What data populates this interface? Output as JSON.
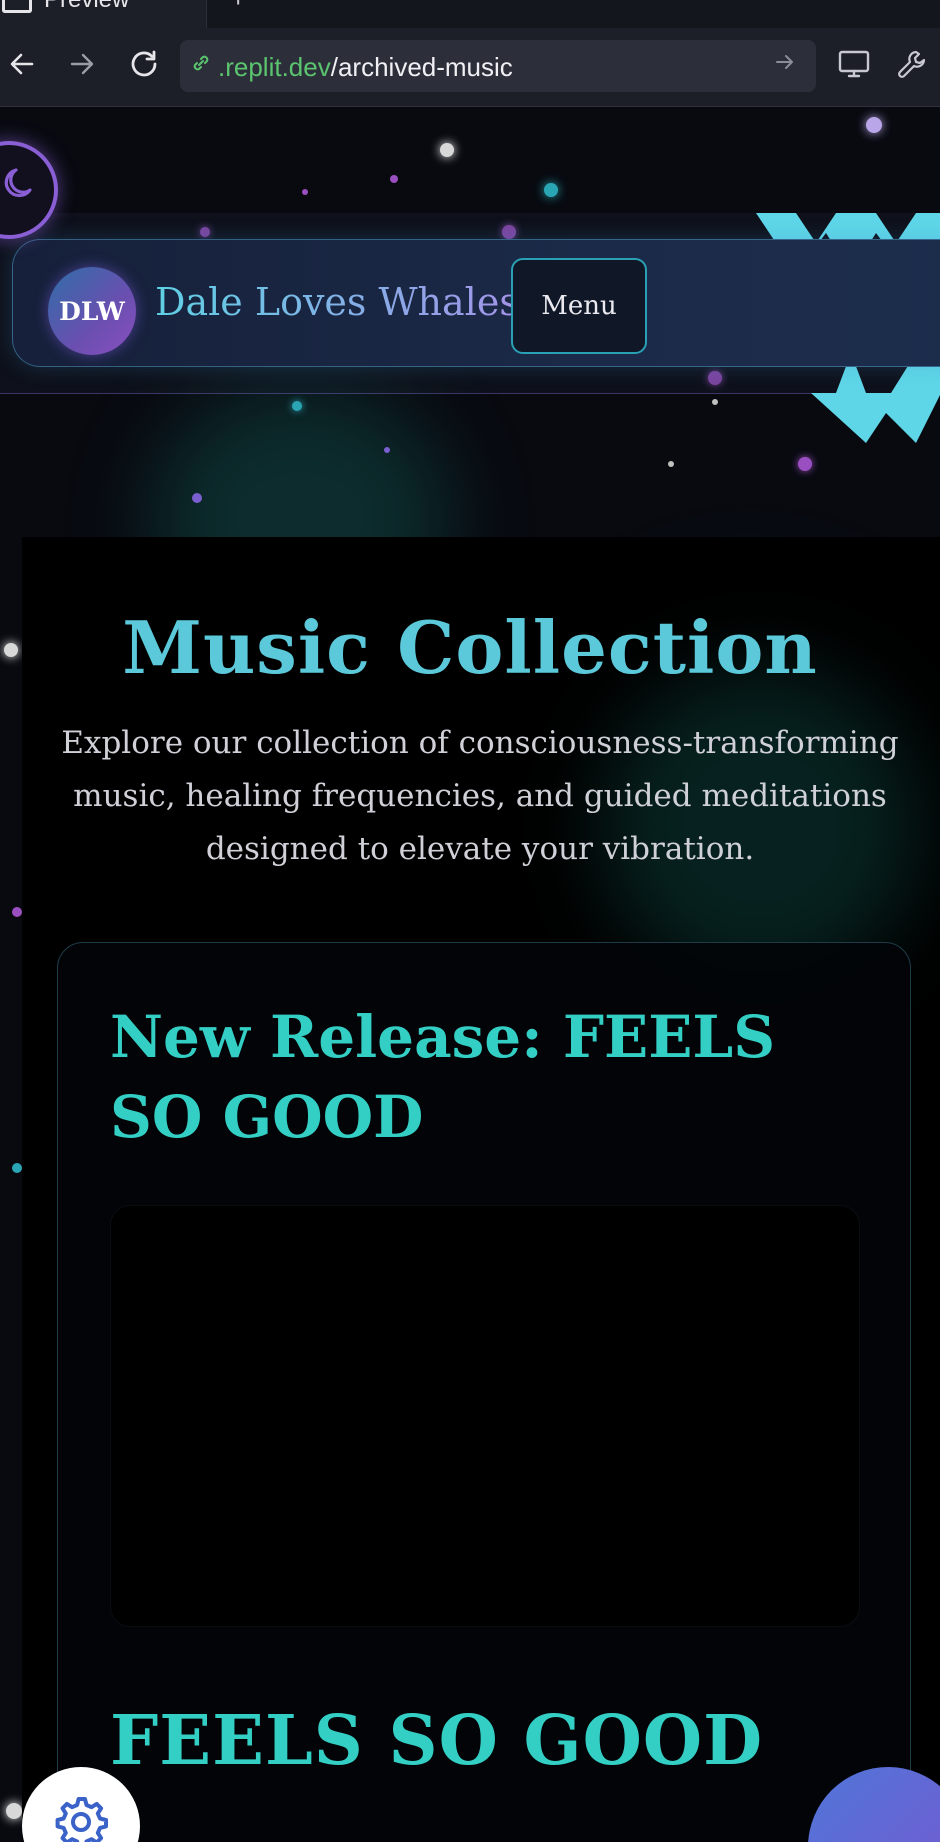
{
  "browser": {
    "tab_label": "Preview",
    "tab_close": "×",
    "new_tab": "+",
    "back_icon": "arrow-left-icon",
    "forward_icon": "arrow-right-icon",
    "reload_icon": "reload-icon",
    "url_domain": ".replit.dev",
    "url_path": "/archived-music",
    "devtools_icon": "monitor-icon",
    "tools_icon": "wrench-icon"
  },
  "site": {
    "logo_initials": "DLW",
    "brand_name": "Dale Loves Whales",
    "menu_label": "Menu",
    "theme_toggle_icon": "moon-icon"
  },
  "main": {
    "title": "Music Collection",
    "intro": "Explore our collection of consciousness-transforming music, healing frequencies, and guided meditations designed to elevate your vibration.",
    "release_heading": "New Release: FEELS SO GOOD",
    "song_title": "FEELS SO GOOD"
  },
  "colors": {
    "accent_teal": "#34cfc4",
    "heading_cyan": "#5cc9da",
    "purple": "#8a5fd6",
    "background": "#080a10"
  }
}
